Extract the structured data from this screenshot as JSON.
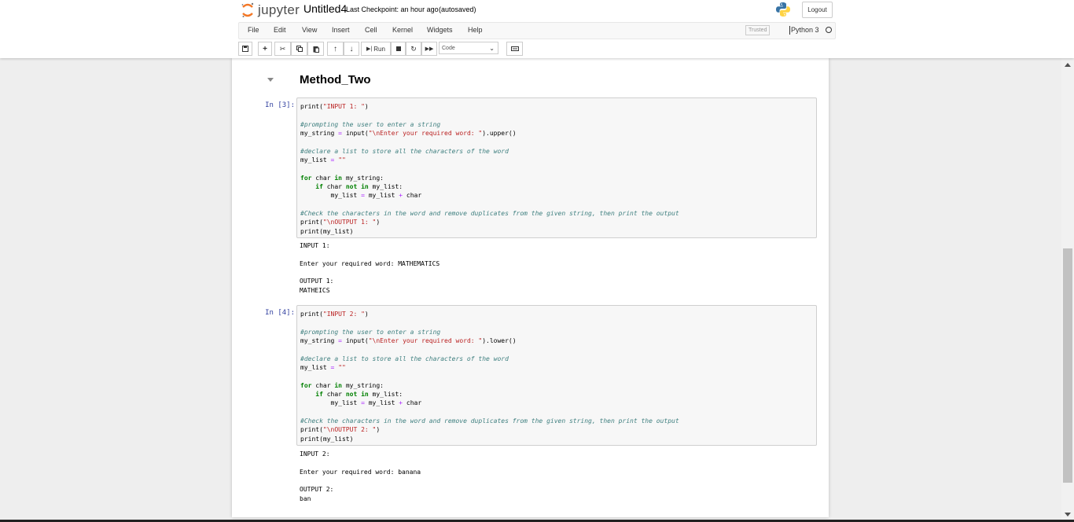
{
  "header": {
    "logo_text": "jupyter",
    "notebook_name": "Untitled4",
    "checkpoint": "Last Checkpoint: an hour ago",
    "autosave": "(autosaved)",
    "logout_label": "Logout"
  },
  "menubar": {
    "items": [
      "File",
      "Edit",
      "View",
      "Insert",
      "Cell",
      "Kernel",
      "Widgets",
      "Help"
    ],
    "trusted_label": "Trusted",
    "kernel_name": "Python 3"
  },
  "toolbar": {
    "run_label": "Run",
    "cell_type": "Code"
  },
  "notebook": {
    "heading": "Method_Two",
    "cells": [
      {
        "prompt": "In [3]:",
        "code_lines": [
          "print(\"INPUT 1: \")",
          "",
          "#prompting the user to enter a string",
          "my_string = input(\"\\nEnter your required word: \").upper()",
          "",
          "#declare a list to store all the characters of the word",
          "my_list = \"\"",
          "",
          "for char in my_string:",
          "    if char not in my_list:",
          "        my_list = my_list + char",
          "",
          "#Check the characters in the word and remove duplicates from the given string, then print the output",
          "print(\"\\nOUTPUT 1: \")",
          "print(my_list)"
        ],
        "output_lines": [
          "INPUT 1:",
          "",
          "Enter your required word: MATHEMATICS",
          "",
          "OUTPUT 1:",
          "MATHEICS"
        ]
      },
      {
        "prompt": "In [4]:",
        "code_lines": [
          "print(\"INPUT 2: \")",
          "",
          "#prompting the user to enter a string",
          "my_string = input(\"\\nEnter your required word: \").lower()",
          "",
          "#declare a list to store all the characters of the word",
          "my_list = \"\"",
          "",
          "for char in my_string:",
          "    if char not in my_list:",
          "        my_list = my_list + char",
          "",
          "#Check the characters in the word and remove duplicates from the given string, then print the output",
          "print(\"\\nOUTPUT 2: \")",
          "print(my_list)"
        ],
        "output_lines": [
          "INPUT 2:",
          "",
          "Enter your required word: banana",
          "",
          "OUTPUT 2:",
          "ban"
        ]
      }
    ]
  }
}
